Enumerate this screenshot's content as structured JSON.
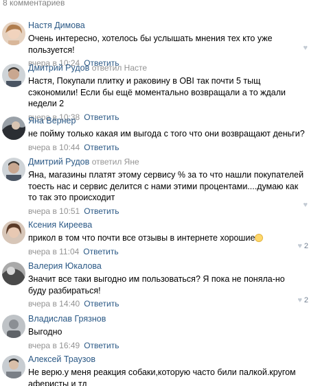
{
  "header": {
    "count_label": "8 комментариев"
  },
  "comments": [
    {
      "author": "Настя Димова",
      "reply_to": "",
      "text": "Очень интересно, хотелось бы услышать мнения тех кто уже пользуется!",
      "time": "вчера в 10:24",
      "reply_label": "Ответить",
      "likes": ""
    },
    {
      "author": "Дмитрий Рудов",
      "reply_to": "ответил Насте",
      "text": "Настя, Покупали плитку и раковину в OBI так почти 5 тыщ сэкономили! Если бы ещё моментально возвращали а то ждали недели 2",
      "time": "вчера в 10:38",
      "reply_label": "Ответить",
      "likes": ""
    },
    {
      "author": "Яна Вернер",
      "reply_to": "",
      "text": "не пойму только какая им выгода с того что они возвращают деньги?",
      "time": "вчера в 10:44",
      "reply_label": "Ответить",
      "likes": ""
    },
    {
      "author": "Дмитрий Рудов",
      "reply_to": "ответил Яне",
      "text": "Яна, магазины платят этому сервису % за то что нашли покупателей тоесть нас и сервис делится с нами этими процентами....думаю как то так это происходит",
      "time": "вчера в 10:51",
      "reply_label": "Ответить",
      "likes": ""
    },
    {
      "author": "Ксения Киреева",
      "reply_to": "",
      "text": "прикол в том что почти все отзывы в интернете хорошие",
      "time": "вчера в 11:04",
      "reply_label": "Ответить",
      "likes": "2"
    },
    {
      "author": "Валерия Юкалова",
      "reply_to": "",
      "text": "Значит все таки выгодно им пользоваться? Я пока не поняла-но буду разбираться!",
      "time": "вчера в 14:40",
      "reply_label": "Ответить",
      "likes": "2"
    },
    {
      "author": "Владислав Грязнов",
      "reply_to": "",
      "text": "Выгодно",
      "time": "вчера в 16:49",
      "reply_label": "Ответить",
      "likes": ""
    },
    {
      "author": "Алексей Траузов",
      "reply_to": "",
      "text": "Не верю.у меня реакция собаки,которую часто били палкой.кругом аферисты и тд",
      "time": "",
      "reply_label": "",
      "likes": ""
    }
  ],
  "icons": {
    "like": "heart-icon",
    "emoji": "smiling-face-emoji"
  }
}
